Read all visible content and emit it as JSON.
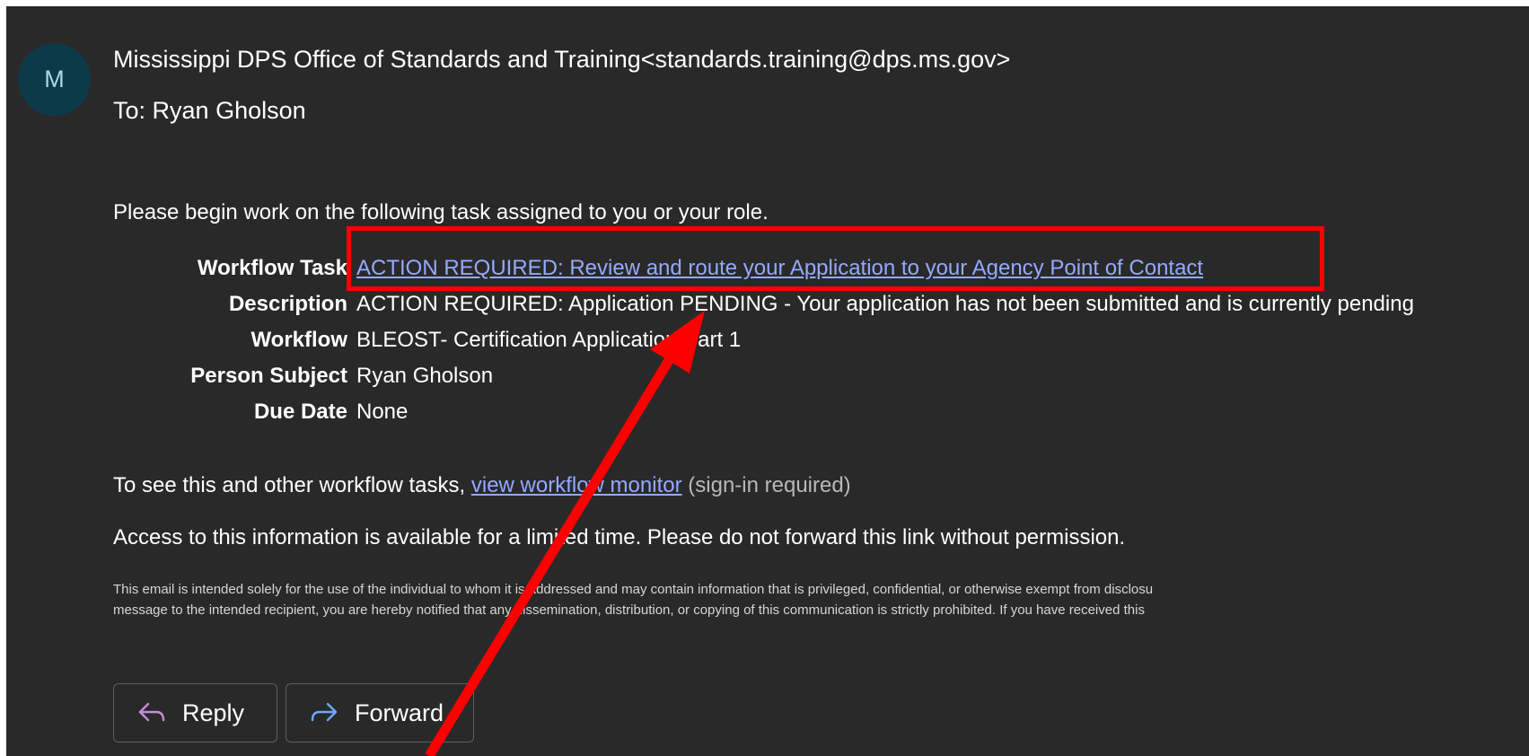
{
  "email": {
    "avatar_initial": "M",
    "sender": "Mississippi DPS Office of Standards and Training<standards.training@dps.ms.gov>",
    "to_label": "To:",
    "to_name": "Ryan Gholson",
    "intro": "Please begin work on the following task assigned to you or your role.",
    "details": [
      {
        "label": "Workflow Task",
        "value": "ACTION REQUIRED: Review and route your Application to your Agency Point of Contact"
      },
      {
        "label": "Description",
        "value": "ACTION REQUIRED: Application PENDING - Your application has not been submitted and is currently pending"
      },
      {
        "label": "Workflow",
        "value": "BLEOST- Certification Application Part 1"
      },
      {
        "label": "Person Subject",
        "value": "Ryan Gholson"
      },
      {
        "label": "Due Date",
        "value": "None"
      }
    ],
    "monitor_prefix": "To see this and other workflow tasks,",
    "monitor_link": "view workflow monitor",
    "monitor_suffix": "(sign-in required)",
    "access_notice": "Access to this information is available for a limited time. Please do not forward this link without permission.",
    "disclaimer_line1": "This email is intended solely for the use of the individual to whom it is addressed and may contain information that is privileged, confidential, or otherwise exempt from disclosu",
    "disclaimer_line2": "message to the intended recipient, you are hereby notified that any dissemination, distribution, or copying of this communication is strictly prohibited. If you have received this"
  },
  "actions": {
    "reply_label": "Reply",
    "forward_label": "Forward"
  },
  "annotations": {
    "highlight_color": "#ff0000",
    "arrow_color": "#ff0000"
  },
  "colors": {
    "background": "#292929",
    "link": "#95a9ff",
    "avatar_bg": "#0d3a48",
    "reply_icon": "#c98bd8",
    "forward_icon": "#6ea8ff"
  }
}
